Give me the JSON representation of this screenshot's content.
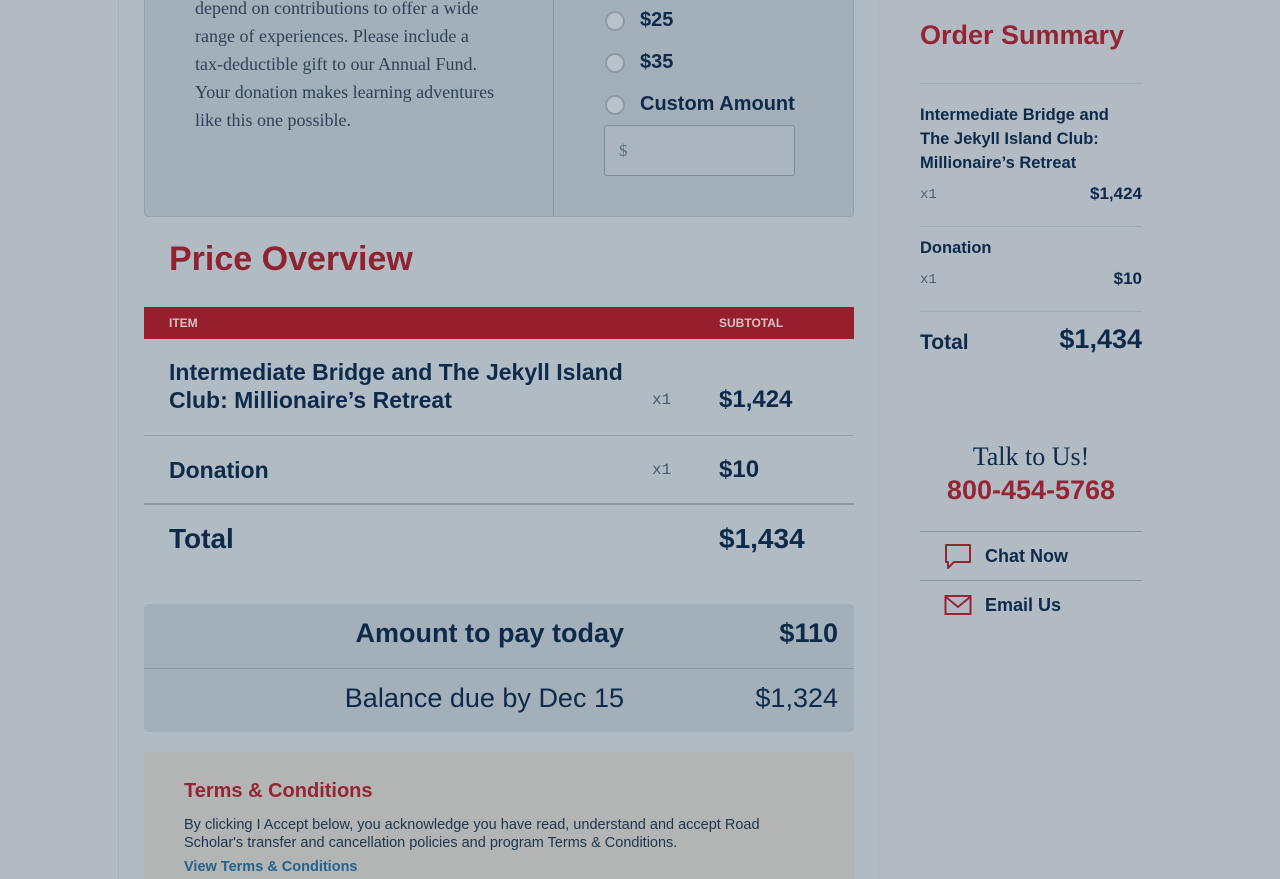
{
  "donation": {
    "text": "depend on contributions to offer a wide range of experiences. Please include a tax-deductible gift to our Annual Fund. Your donation makes learning adventures like this one possible.",
    "options": [
      {
        "label": "$25"
      },
      {
        "label": "$35"
      },
      {
        "label": "Custom Amount"
      }
    ],
    "custom_placeholder": "$"
  },
  "price_overview": {
    "title": "Price Overview",
    "col_item": "ITEM",
    "col_subtotal": "SUBTOTAL",
    "rows": [
      {
        "name": "Intermediate Bridge and The Jekyll Island Club: Millionaire’s Retreat",
        "qty": "x1",
        "price": "$1,424"
      },
      {
        "name": "Donation",
        "qty": "x1",
        "price": "$10"
      }
    ],
    "total_label": "Total",
    "total_value": "$1,434"
  },
  "payment": {
    "today_label": "Amount to pay today",
    "today_value": "$110",
    "balance_label": "Balance due by Dec 15",
    "balance_value": "$1,324"
  },
  "terms": {
    "title": "Terms & Conditions",
    "text": "By clicking I Accept below, you acknowledge you have read, understand and accept Road Scholar's transfer and cancellation policies and program Terms & Conditions.",
    "link": "View Terms & Conditions"
  },
  "summary": {
    "title": "Order Summary",
    "items": [
      {
        "name": "Intermediate Bridge and The Jekyll Island Club: Millionaire’s Retreat",
        "qty": "x1",
        "price": "$1,424"
      },
      {
        "name": "Donation",
        "qty": "x1",
        "price": "$10"
      }
    ],
    "total_label": "Total",
    "total_value": "$1,434"
  },
  "contact": {
    "talk": "Talk to Us!",
    "phone": "800-454-5768",
    "chat": "Chat Now",
    "email": "Email Us"
  },
  "colors": {
    "accent_red": "#952533",
    "navy": "#0d2a4a",
    "link_blue": "#24628c"
  }
}
